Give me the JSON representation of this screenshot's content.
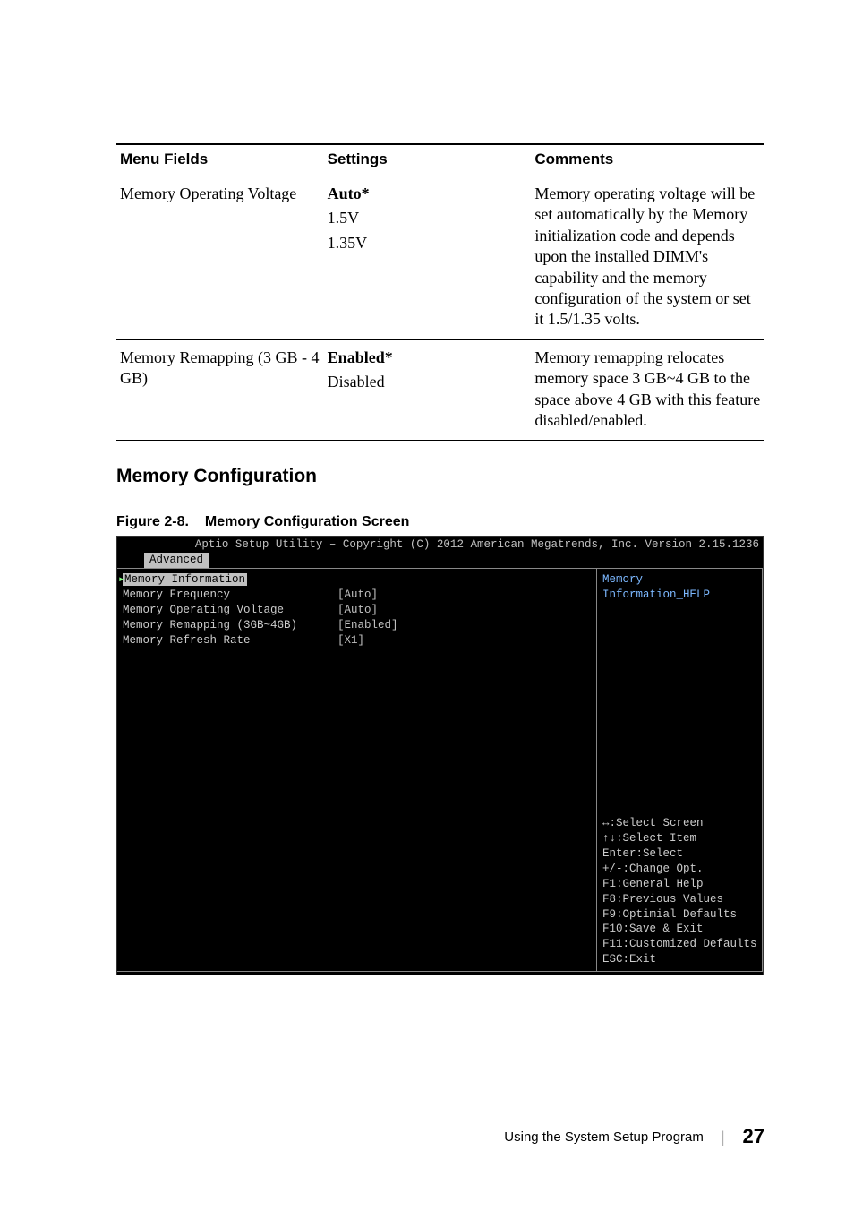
{
  "table": {
    "headers": {
      "field": "Menu Fields",
      "settings": "Settings",
      "comments": "Comments"
    },
    "rows": [
      {
        "field": "Memory Operating Voltage",
        "settings": [
          {
            "text": "Auto*",
            "bold": true
          },
          {
            "text": "1.5V",
            "bold": false
          },
          {
            "text": "1.35V",
            "bold": false
          }
        ],
        "comments": "Memory operating voltage will be set automatically by the Memory initialization code and depends upon the installed DIMM's capability and the memory configuration of the system or set it 1.5/1.35 volts."
      },
      {
        "field": "Memory Remapping (3 GB - 4 GB)",
        "settings": [
          {
            "text": "Enabled*",
            "bold": true
          },
          {
            "text": "Disabled",
            "bold": false
          }
        ],
        "comments": "Memory remapping relocates memory space 3 GB~4 GB to the space above 4 GB with this feature disabled/enabled."
      }
    ]
  },
  "section_heading": "Memory Configuration",
  "figure": {
    "num": "Figure 2-8.",
    "title": "Memory Configuration Screen"
  },
  "bios": {
    "header": "Aptio Setup Utility – Copyright (C) 2012 American Megatrends, Inc.  Version 2.15.1236",
    "tab": "Advanced",
    "items": [
      {
        "label": "Memory Information",
        "value": "",
        "selected": true
      },
      {
        "label": "Memory Frequency",
        "value": "[Auto]",
        "selected": false
      },
      {
        "label": "Memory Operating Voltage",
        "value": "[Auto]",
        "selected": false
      },
      {
        "label": "Memory Remapping (3GB~4GB)",
        "value": "[Enabled]",
        "selected": false
      },
      {
        "label": "Memory Refresh Rate",
        "value": "[X1]",
        "selected": false
      }
    ],
    "help_top": [
      "Memory",
      "Information_HELP"
    ],
    "keys": [
      "↔:Select Screen",
      "↑↓:Select Item",
      "Enter:Select",
      "+/-:Change Opt.",
      "F1:General Help",
      "F8:Previous Values",
      "F9:Optimial Defaults",
      "F10:Save & Exit",
      "F11:Customized Defaults",
      "ESC:Exit"
    ]
  },
  "footer": {
    "chapter": "Using the System Setup Program",
    "page": "27"
  },
  "chart_data": null
}
